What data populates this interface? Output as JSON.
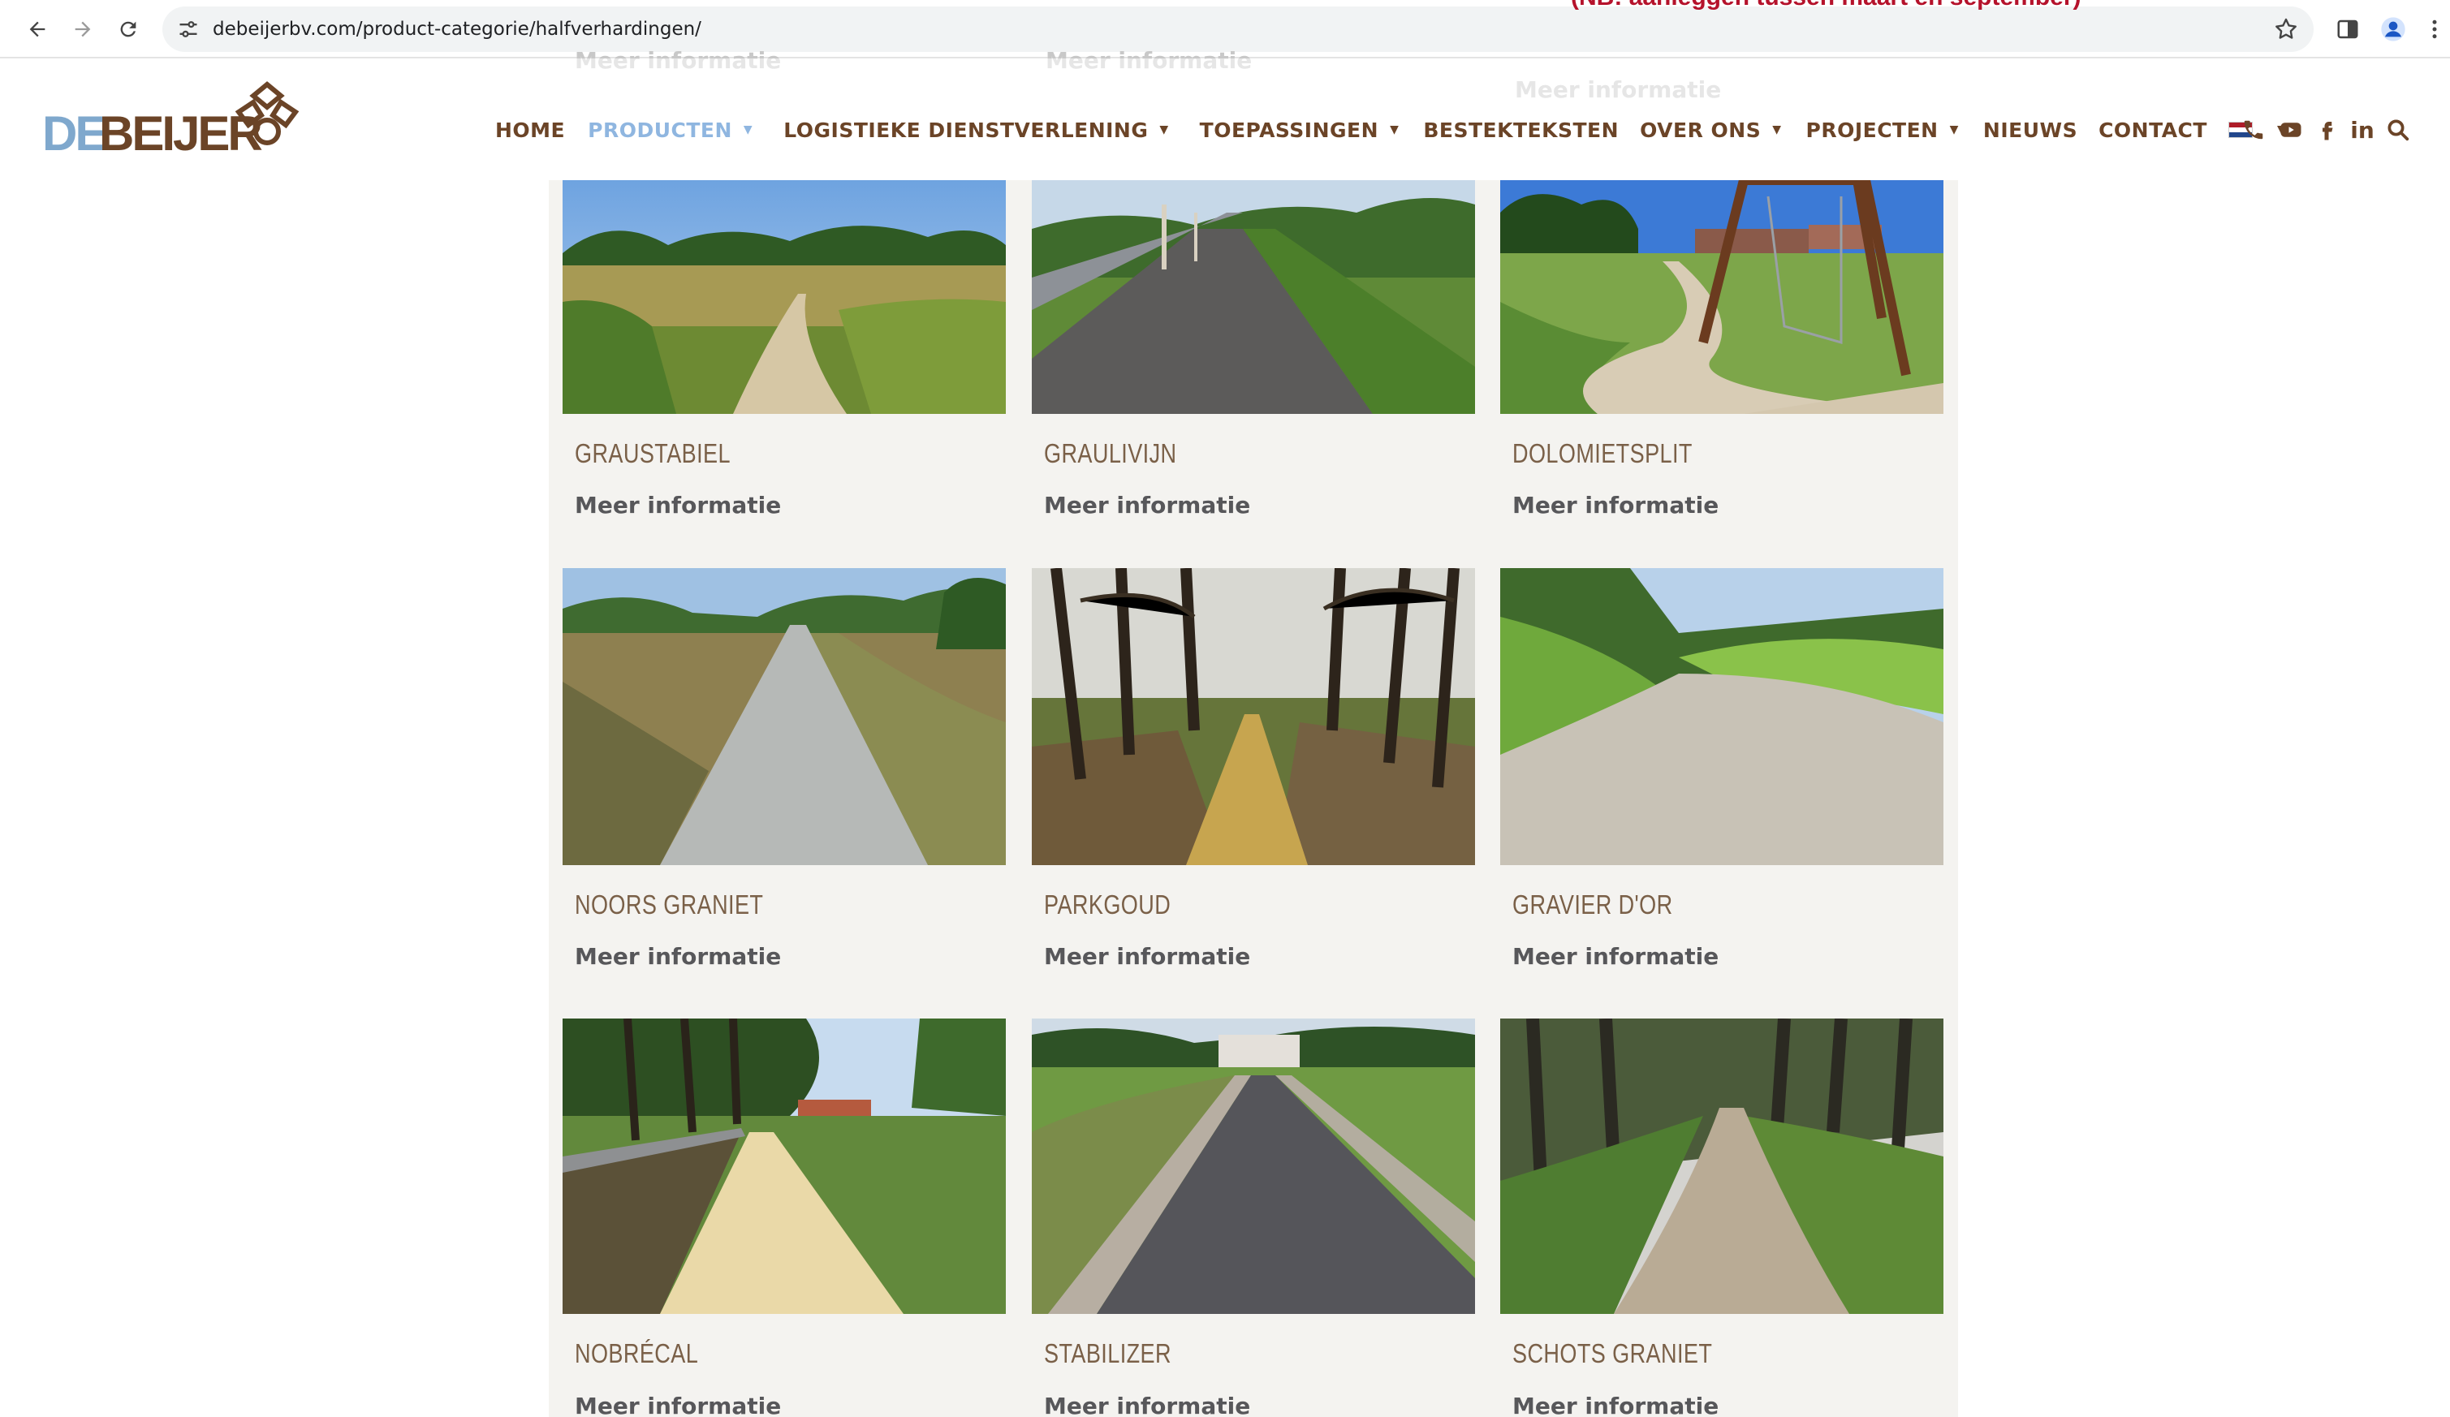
{
  "browser": {
    "url": "debeijerbv.com/product-categorie/halfverhardingen/",
    "banner_fragment": "(NB: aanleggen tussen maart en september)"
  },
  "logo": {
    "part1": "DE",
    "part2": "BEIJER"
  },
  "nav": {
    "items": [
      {
        "label": "HOME",
        "dropdown": false,
        "active": false
      },
      {
        "label": "PRODUCTEN",
        "dropdown": true,
        "active": true
      },
      {
        "label": "LOGISTIEKE DIENSTVERLENING",
        "dropdown": true,
        "active": false
      },
      {
        "label": "TOEPASSINGEN",
        "dropdown": true,
        "active": false
      },
      {
        "label": "BESTEKTEKSTEN",
        "dropdown": false,
        "active": false
      },
      {
        "label": "OVER ONS",
        "dropdown": true,
        "active": false
      },
      {
        "label": "PROJECTEN",
        "dropdown": true,
        "active": false
      },
      {
        "label": "NIEUWS",
        "dropdown": false,
        "active": false
      },
      {
        "label": "CONTACT",
        "dropdown": false,
        "active": false
      }
    ],
    "social_linkedin": "in"
  },
  "faded_more": "Meer informatie",
  "products": [
    {
      "title": "GRAUSTABIEL",
      "more": "Meer informatie"
    },
    {
      "title": "GRAULIVIJN",
      "more": "Meer informatie"
    },
    {
      "title": "DOLOMIETSPLIT",
      "more": "Meer informatie"
    },
    {
      "title": "NOORS GRANIET",
      "more": "Meer informatie"
    },
    {
      "title": "PARKGOUD",
      "more": "Meer informatie"
    },
    {
      "title": "GRAVIER D'OR",
      "more": "Meer informatie"
    },
    {
      "title": "NOBRÉCAL",
      "more": "Meer informatie"
    },
    {
      "title": "STABILIZER",
      "more": "Meer informatie"
    },
    {
      "title": "SCHOTS GRANIET",
      "more": "Meer informatie"
    }
  ],
  "colors": {
    "brand_brown": "#6b4427",
    "brand_blue": "#8fb6e0",
    "card_bg": "#f4f3f0"
  }
}
